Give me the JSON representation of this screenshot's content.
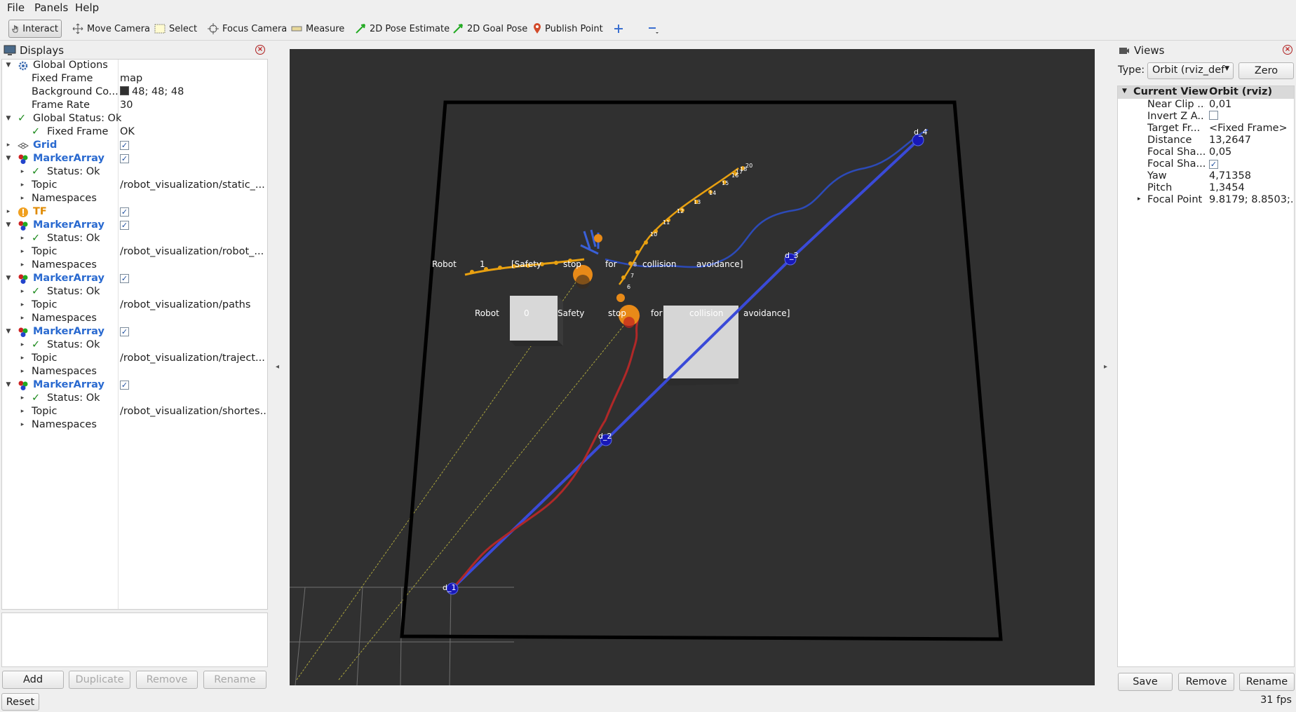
{
  "menu": [
    "File",
    "Panels",
    "Help"
  ],
  "toolbar": {
    "interact": "Interact",
    "move_camera": "Move Camera",
    "select": "Select",
    "focus_camera": "Focus Camera",
    "measure": "Measure",
    "pose_estimate": "2D Pose Estimate",
    "goal_pose": "2D Goal Pose",
    "publish_point": "Publish Point"
  },
  "displays": {
    "title": "Displays",
    "rows": [
      {
        "label": "Global Options"
      },
      {
        "label": "Fixed Frame",
        "value": "map"
      },
      {
        "label": "Background Co...",
        "value": "48; 48; 48",
        "color": "#303030"
      },
      {
        "label": "Frame Rate",
        "value": "30"
      },
      {
        "label": "Global Status: Ok"
      },
      {
        "label": "Fixed Frame",
        "value": "OK"
      },
      {
        "label": "Grid"
      },
      {
        "label": "MarkerArray"
      },
      {
        "label": "Status: Ok"
      },
      {
        "label": "Topic",
        "value": "/robot_visualization/static_..."
      },
      {
        "label": "Namespaces"
      },
      {
        "label": "TF"
      },
      {
        "label": "MarkerArray"
      },
      {
        "label": "Status: Ok"
      },
      {
        "label": "Topic",
        "value": "/robot_visualization/robot_..."
      },
      {
        "label": "Namespaces"
      },
      {
        "label": "MarkerArray"
      },
      {
        "label": "Status: Ok"
      },
      {
        "label": "Topic",
        "value": "/robot_visualization/paths"
      },
      {
        "label": "Namespaces"
      },
      {
        "label": "MarkerArray"
      },
      {
        "label": "Status: Ok"
      },
      {
        "label": "Topic",
        "value": "/robot_visualization/traject..."
      },
      {
        "label": "Namespaces"
      },
      {
        "label": "MarkerArray"
      },
      {
        "label": "Status: Ok"
      },
      {
        "label": "Topic",
        "value": "/robot_visualization/shortes..."
      },
      {
        "label": "Namespaces"
      }
    ],
    "buttons": {
      "add": "Add",
      "duplicate": "Duplicate",
      "remove": "Remove",
      "rename": "Rename"
    }
  },
  "scene": {
    "nodes": [
      "d_1",
      "d_2",
      "d_3",
      "d_4"
    ],
    "robot1_text": [
      "Robot",
      "1",
      "[Safety",
      "stop",
      "for",
      "collision",
      "avoidance]"
    ],
    "robot0_text": [
      "Robot",
      "0",
      "Safety",
      "stop",
      "for",
      "collision",
      "avoidance]"
    ],
    "traj_labels": [
      "6",
      "7",
      "8",
      "10",
      "11",
      "12",
      "13",
      "14",
      "15",
      "16",
      "17",
      "18",
      "20"
    ]
  },
  "views": {
    "title": "Views",
    "type_label": "Type:",
    "type_value": "Orbit (rviz_def",
    "zero": "Zero",
    "header": {
      "name": "Current View",
      "value": "Orbit (rviz)"
    },
    "props": [
      {
        "k": "Near Clip ...",
        "v": "0,01"
      },
      {
        "k": "Invert Z A...",
        "v": ""
      },
      {
        "k": "Target Fr...",
        "v": "<Fixed Frame>"
      },
      {
        "k": "Distance",
        "v": "13,2647"
      },
      {
        "k": "Focal Sha...",
        "v": "0,05"
      },
      {
        "k": "Focal Sha...",
        "v": ""
      },
      {
        "k": "Yaw",
        "v": "4,71358"
      },
      {
        "k": "Pitch",
        "v": "1,3454"
      },
      {
        "k": "Focal Point",
        "v": "9.8179; 8.8503;..."
      }
    ],
    "buttons": {
      "save": "Save",
      "remove": "Remove",
      "rename": "Rename"
    }
  },
  "status": {
    "reset": "Reset",
    "fps": "31 fps"
  }
}
